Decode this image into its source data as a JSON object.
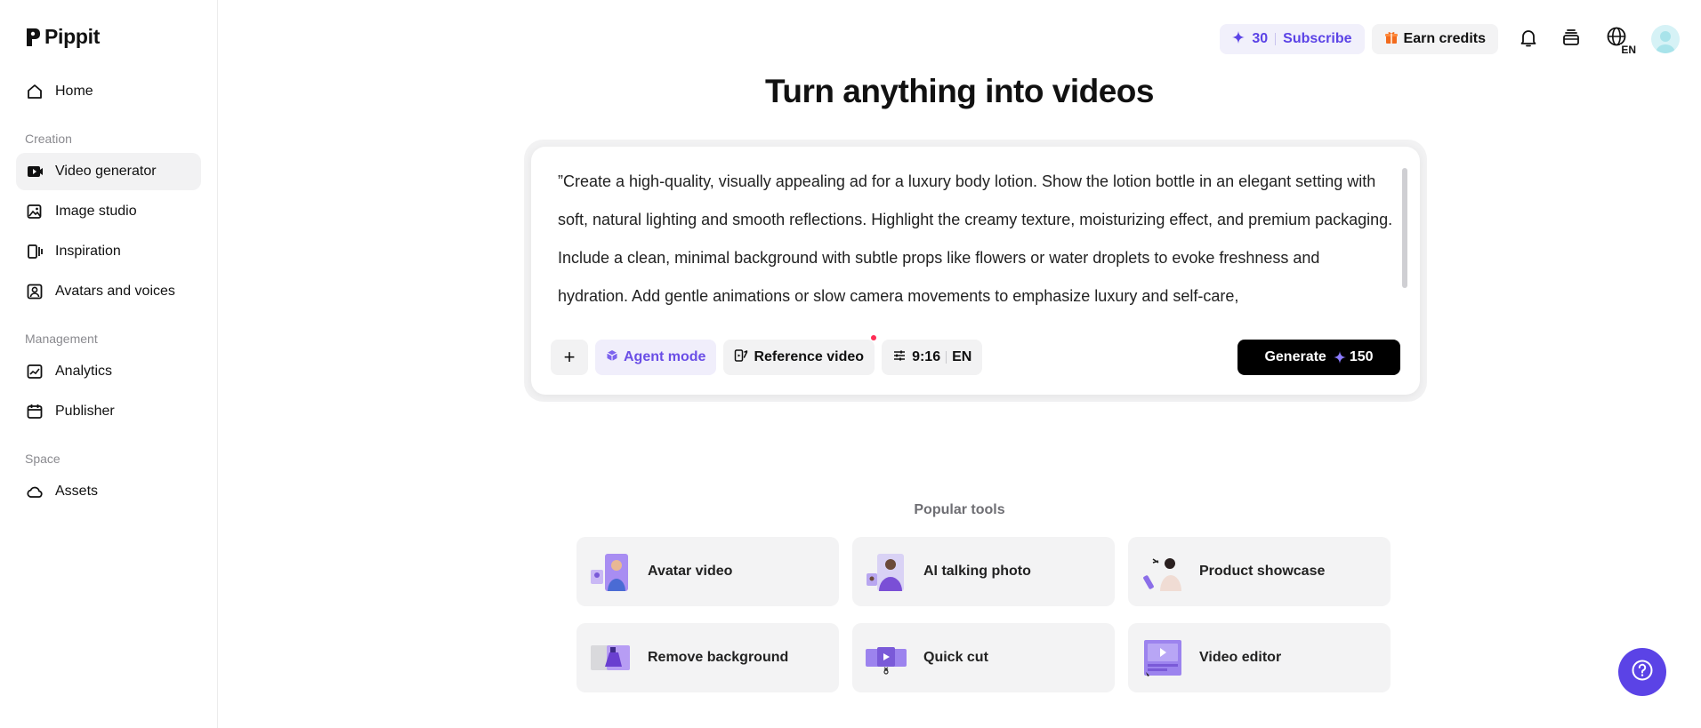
{
  "app": {
    "name": "Pippit"
  },
  "sidebar": {
    "home": "Home",
    "sections": {
      "creation": "Creation",
      "management": "Management",
      "space": "Space"
    },
    "items": {
      "video_generator": "Video generator",
      "image_studio": "Image studio",
      "inspiration": "Inspiration",
      "avatars_voices": "Avatars and voices",
      "analytics": "Analytics",
      "publisher": "Publisher",
      "assets": "Assets"
    },
    "active": "Video generator"
  },
  "header": {
    "credits": "30",
    "subscribe": "Subscribe",
    "earn_credits": "Earn credits",
    "language": "EN"
  },
  "main": {
    "title": "Turn anything into videos",
    "prompt": "”Create a high-quality, visually appealing ad for a luxury body lotion. Show the lotion bottle in an elegant setting with soft, natural lighting and smooth reflections. Highlight the creamy texture, moisturizing effect, and premium packaging. Include a clean, minimal background with subtle props like flowers or water droplets to evoke freshness and hydration. Add gentle animations or slow camera movements to emphasize luxury and self-care,",
    "toolbar": {
      "plus": "+",
      "agent_mode": "Agent mode",
      "reference_video": "Reference video",
      "aspect": "9:16",
      "lang": "EN"
    },
    "generate": {
      "label": "Generate",
      "cost": "150"
    }
  },
  "popular": {
    "label": "Popular tools",
    "tools": [
      {
        "label": "Avatar video",
        "icon": "avatar-video-thumb"
      },
      {
        "label": "AI talking photo",
        "icon": "talking-photo-thumb"
      },
      {
        "label": "Product showcase",
        "icon": "product-showcase-thumb"
      },
      {
        "label": "Remove background",
        "icon": "remove-bg-thumb"
      },
      {
        "label": "Quick cut",
        "icon": "quick-cut-thumb"
      },
      {
        "label": "Video editor",
        "icon": "video-editor-thumb"
      }
    ]
  },
  "colors": {
    "accent": "#5b43e6",
    "agent_text": "#6a4ee6",
    "active_bg": "#f2f2f3",
    "notify_dot": "#ff2d55"
  }
}
